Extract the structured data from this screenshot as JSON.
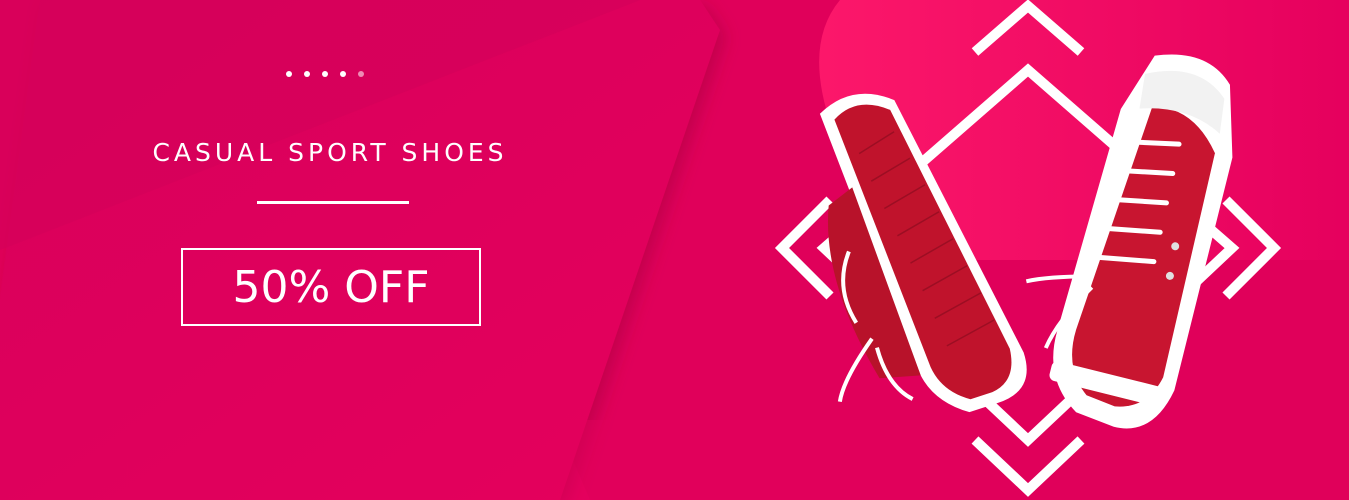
{
  "banner": {
    "title": "CASUAL SPORT SHOES",
    "offer_label": "50% OFF",
    "slider_dot_count": 5,
    "active_slide": 4,
    "colors": {
      "background": "#e3005a",
      "text": "#ffffff",
      "shoe": "#c81530"
    },
    "image": {
      "icon": "red-sneakers-icon"
    }
  }
}
